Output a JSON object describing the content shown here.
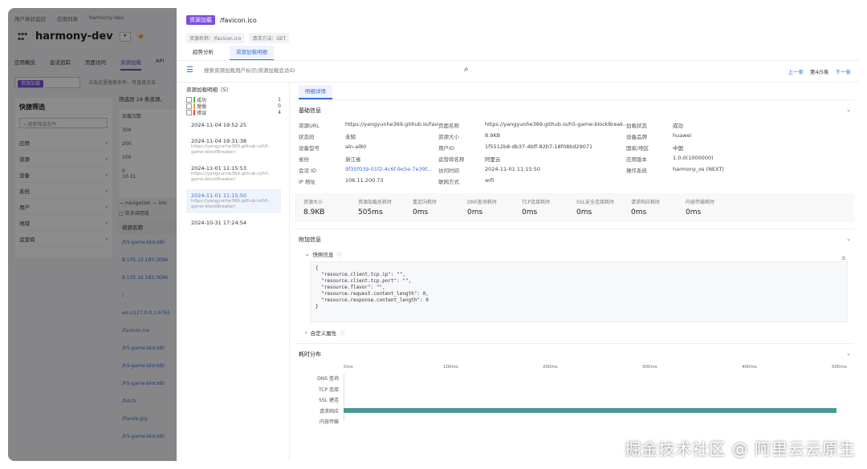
{
  "background": {
    "breadcrumb": [
      "用户体验监控",
      "应用列表",
      "harmony-dev"
    ],
    "app_title": "harmony-dev",
    "tabs": [
      "应用概览",
      "会话追踪",
      "页面访问",
      "资源加载",
      "API"
    ],
    "active_tab": "资源加载",
    "filter_tag": "资源加载",
    "search_tip": "点击这里搜索条件，可直接点击",
    "quick_filter": {
      "title": "快捷筛选",
      "search_placeholder": "搜索筛选条件",
      "items": [
        "应用",
        "资源",
        "设备",
        "系统",
        "用户",
        "地域",
        "运营商"
      ]
    },
    "stat_text": "筛选到 19 条资源，",
    "chart_title": "加载次数",
    "chart_ticks": [
      "300",
      "200",
      "100",
      "0"
    ],
    "chart_x": "10-31",
    "legend": "— navigation  — imc",
    "checkbox_label": "□ 仅含调用链",
    "column_header": "资源名称",
    "rows": [
      "/h5-game-blockBr",
      "8.135.10.183:3086",
      "8.135.10.183:3086",
      "/",
      "ws://127.0.0.1:6765",
      "/favicon.ico",
      "/h5-game-blockBr",
      "/h5-game-blockBr",
      "/h5-game-blockBr",
      "/fetch",
      "/Panda.jpg",
      "/h5-game-blockBr"
    ]
  },
  "drawer": {
    "tag": "资源加载",
    "path": "/favicon.ico",
    "meta": [
      "资源名称：/favicon.ico",
      "请求方法：GET"
    ],
    "tabs": [
      "趋势分析",
      "资源加载明细"
    ],
    "active_tab": "资源加载明细",
    "search_placeholder": "搜索资源加载用户标识/资源加载会话ID",
    "nav": {
      "prev": "上一条",
      "page": "第4/5条",
      "next": "下一条"
    },
    "list": {
      "title": "资源加载明细（5）",
      "filters": [
        {
          "label": "成功",
          "count": "1",
          "color": "#3cb371"
        },
        {
          "label": "慢慢",
          "count": "0",
          "color": "#f0a020"
        },
        {
          "label": "错误",
          "count": "4",
          "color": "#e04848"
        }
      ],
      "items": [
        {
          "time": "2024-11-04 19:52:25",
          "sub": ""
        },
        {
          "time": "2024-11-04 19:31:38",
          "sub": "https://yangyunhe369.github.io/h5-game-blockBreaker/"
        },
        {
          "time": "2024-11-01 11:15:53",
          "sub": "https://yangyunhe369.github.io/h5-game-blockBreaker/"
        },
        {
          "time": "2024-11-01 11:15:50",
          "sub": "https://yangyunhe369.github.io/h5-game-blockBreaker/"
        },
        {
          "time": "2024-10-31 17:24:54",
          "sub": ""
        }
      ],
      "selected_index": 3
    },
    "detail": {
      "tab": "明细详情",
      "basic_title": "基础信息",
      "fields": [
        {
          "k": "资源URL",
          "v": "https://yangyunhe369.github.io/favicon.ico"
        },
        {
          "k": "页面名称",
          "v": "https://yangyunhe369.github.io/h5-game-blockBreak..."
        },
        {
          "k": "加载状态",
          "v": "成功"
        },
        {
          "k": "状态码",
          "v": "未知"
        },
        {
          "k": "资源大小",
          "v": "8.9KB"
        },
        {
          "k": "设备品牌",
          "v": "huawei"
        },
        {
          "k": "设备型号",
          "v": "aln-al80"
        },
        {
          "k": "用户ID",
          "v": "1f5512b8-db37-4bff-82b7-18f08bd29071"
        },
        {
          "k": "国家/地区",
          "v": "中国"
        },
        {
          "k": "省份",
          "v": "浙江省"
        },
        {
          "k": "运营商名称",
          "v": "阿里云"
        },
        {
          "k": "应用版本",
          "v": "1.0.0(1000000)"
        },
        {
          "k": "会话 ID",
          "v": "9f35f039-01f2-4c6f-9e5e-7e39f..."
        },
        {
          "k": "访问时间",
          "v": "2024-11-01 11:15:50"
        },
        {
          "k": "操作系统",
          "v": "harmony_os (NEXT)"
        },
        {
          "k": "IP 地址",
          "v": "106.11.200.73"
        },
        {
          "k": "联网方式",
          "v": "wifi"
        },
        {
          "k": "",
          "v": ""
        }
      ],
      "metrics": [
        {
          "label": "资源大小",
          "value": "8.9KB"
        },
        {
          "label": "资源加载总耗时",
          "value": "505ms"
        },
        {
          "label": "重定向耗时",
          "value": "0ms"
        },
        {
          "label": "DNS查询耗时",
          "value": "0ms"
        },
        {
          "label": "TCP连接耗时",
          "value": "0ms"
        },
        {
          "label": "SSL安全连接耗时",
          "value": "0ms"
        },
        {
          "label": "请求响应耗时",
          "value": "0ms"
        },
        {
          "label": "内容传输耗时",
          "value": "0ms"
        }
      ],
      "extra_title": "附加信息",
      "snapshot_title": "快照信息",
      "code": "{\n  \"resource.client.tcp.ip\": \"\",\n  \"resource.client.tcp.port\": \"\",\n  \"resource.flavor\": \"\",\n  \"resource.request.content_length\": 0,\n  \"resource.response.content_length\": 0\n}",
      "custom_title": "自定义属性",
      "timing_title": "耗时分布",
      "timing_ticks": [
        "0ms",
        "100ms",
        "200ms",
        "300ms",
        "400ms",
        "500ms"
      ],
      "timing_rows": [
        "DNS 查询",
        "TCP 连接",
        "SSL 建连",
        "请求响应",
        "内容传输"
      ],
      "timing_bar_fraction": 0.99
    }
  },
  "watermark": "掘金技术社区 @ 阿里云云原生"
}
